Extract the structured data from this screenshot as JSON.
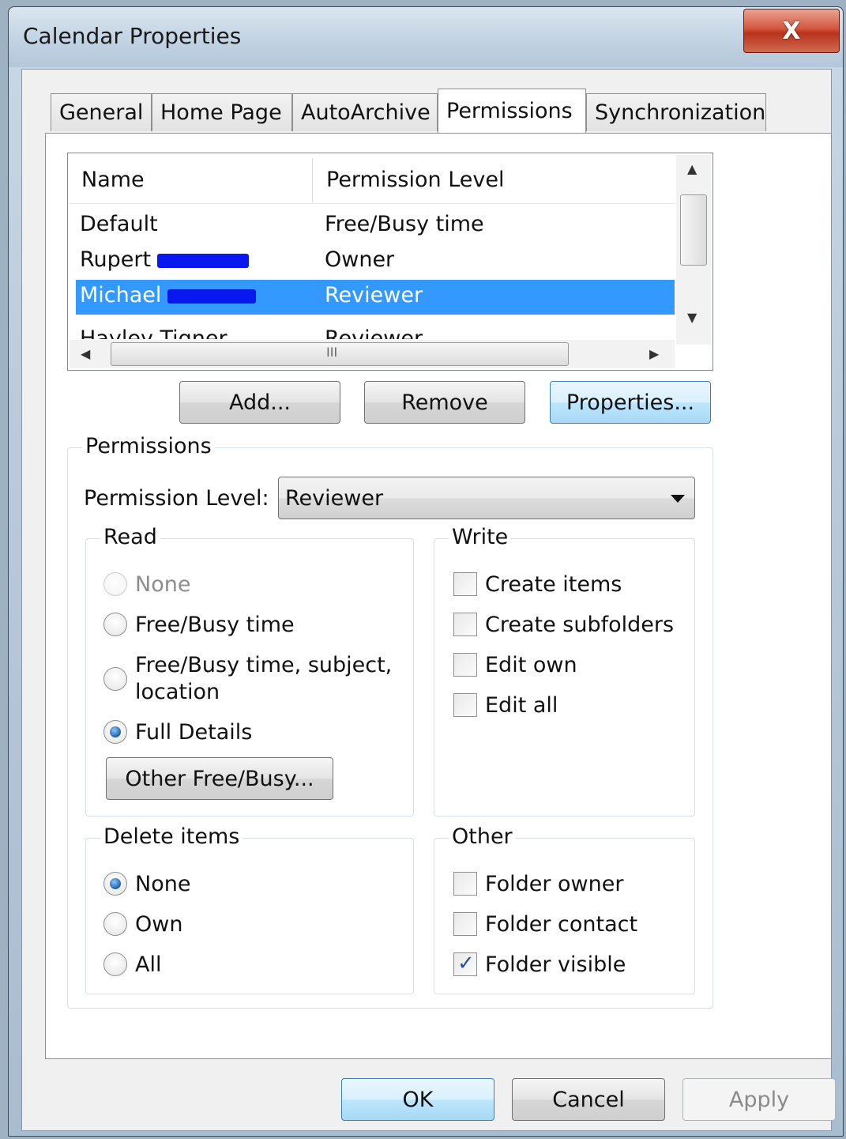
{
  "window": {
    "title": "Calendar Properties",
    "close_glyph": "X"
  },
  "tabs": [
    {
      "label": "General"
    },
    {
      "label": "Home Page"
    },
    {
      "label": "AutoArchive"
    },
    {
      "label": "Permissions"
    },
    {
      "label": "Synchronization"
    }
  ],
  "active_tab": "Permissions",
  "users_list": {
    "columns": [
      "Name",
      "Permission Level"
    ],
    "rows": [
      {
        "name": "Default",
        "level": "Free/Busy time",
        "redacted": false
      },
      {
        "name": "Rupert",
        "level": "Owner",
        "redacted": true
      },
      {
        "name": "Michael",
        "level": "Reviewer",
        "redacted": true,
        "selected": true
      },
      {
        "name": "Hayley Tigner",
        "level": "Reviewer",
        "redacted": false,
        "partially_visible": true
      }
    ],
    "hscroll_grip": "III"
  },
  "list_buttons": {
    "add": "Add...",
    "remove": "Remove",
    "properties": "Properties..."
  },
  "permissions": {
    "group_title": "Permissions",
    "level_label": "Permission Level:",
    "level_value": "Reviewer",
    "read": {
      "title": "Read",
      "options": [
        "None",
        "Free/Busy time",
        "Free/Busy time, subject,",
        "location",
        "Full Details"
      ],
      "selected": "Full Details",
      "other_free_busy": "Other Free/Busy..."
    },
    "write": {
      "title": "Write",
      "items": [
        {
          "label": "Create items",
          "checked": false
        },
        {
          "label": "Create subfolders",
          "checked": false
        },
        {
          "label": "Edit own",
          "checked": false
        },
        {
          "label": "Edit all",
          "checked": false
        }
      ]
    },
    "delete": {
      "title": "Delete items",
      "options": [
        "None",
        "Own",
        "All"
      ],
      "selected": "None"
    },
    "other": {
      "title": "Other",
      "items": [
        {
          "label": "Folder owner",
          "checked": false
        },
        {
          "label": "Folder contact",
          "checked": false
        },
        {
          "label": "Folder visible",
          "checked": true
        }
      ]
    }
  },
  "footer": {
    "ok": "OK",
    "cancel": "Cancel",
    "apply": "Apply"
  },
  "colors": {
    "selection": "#3399ff",
    "redaction": "#0a18f0",
    "close_button": "#c9432a"
  }
}
